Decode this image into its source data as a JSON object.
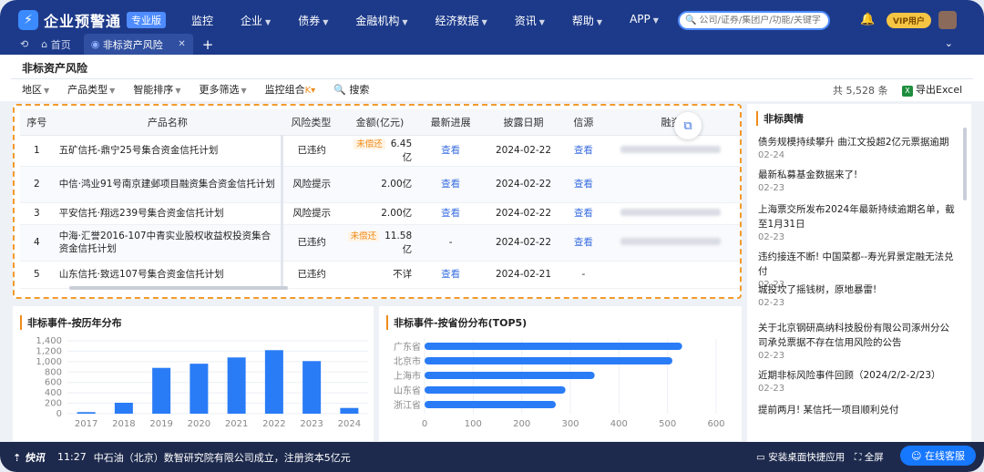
{
  "app": {
    "logo_glyph": "⚡",
    "name": "企业预警通",
    "badge": "专业版"
  },
  "nav": {
    "items": [
      {
        "label": "监控",
        "caret": false
      },
      {
        "label": "企业",
        "caret": true
      },
      {
        "label": "债券",
        "caret": true
      },
      {
        "label": "金融机构",
        "caret": true
      },
      {
        "label": "经济数据",
        "caret": true
      },
      {
        "label": "资讯",
        "caret": true
      },
      {
        "label": "帮助",
        "caret": true
      },
      {
        "label": "APP",
        "caret": true
      }
    ]
  },
  "search": {
    "placeholder": "公司/证券/集团户/功能/关键字"
  },
  "vip_label": "VIP用户",
  "tabs": {
    "home": "首页",
    "active": "非标资产风险"
  },
  "page": {
    "title": "非标资产风险"
  },
  "filters": {
    "region": "地区",
    "product_type": "产品类型",
    "smart_sort": "智能排序",
    "more_filters": "更多筛选",
    "monitor_group": "监控组合",
    "search": "搜索",
    "total": "共 5,528 条",
    "export": "导出Excel"
  },
  "table": {
    "headers": [
      "序号",
      "产品名称",
      "风险类型",
      "金额(亿元)",
      "最新进展",
      "披露日期",
      "信源",
      "融资"
    ],
    "rows": [
      {
        "no": "1",
        "name": "五矿信托-鼎宁25号集合资金信托计划",
        "risk": "已违约",
        "tag": "未偿还",
        "amount": "6.45亿",
        "progress": "查看",
        "date": "2024-02-22",
        "source": "查看"
      },
      {
        "no": "2",
        "name": "中信·鸿业91号南京建邺项目融资集合资金信托计划",
        "risk": "风险提示",
        "tag": "",
        "amount": "2.00亿",
        "progress": "查看",
        "date": "2024-02-22",
        "source": "查看"
      },
      {
        "no": "3",
        "name": "平安信托·翔远239号集合资金信托计划",
        "risk": "风险提示",
        "tag": "",
        "amount": "2.00亿",
        "progress": "查看",
        "date": "2024-02-22",
        "source": "查看"
      },
      {
        "no": "4",
        "name": "中海·汇誉2016-107中青实业股权收益权投资集合资金信托计划",
        "risk": "已违约",
        "tag": "未偿还",
        "amount": "11.58亿",
        "progress": "-",
        "date": "2024-02-22",
        "source": "查看"
      },
      {
        "no": "5",
        "name": "山东信托·致远107号集合资金信托计划",
        "risk": "已违约",
        "tag": "",
        "amount": "不详",
        "progress": "查看",
        "date": "2024-02-21",
        "source": "-"
      }
    ]
  },
  "chart_year": {
    "title": "非标事件-按历年分布",
    "chart_data": {
      "type": "bar",
      "categories": [
        "2017",
        "2018",
        "2019",
        "2020",
        "2021",
        "2022",
        "2023",
        "2024"
      ],
      "values": [
        30,
        210,
        880,
        960,
        1080,
        1220,
        1010,
        110
      ],
      "ylim": [
        0,
        1400
      ],
      "yticks": [
        "1,400",
        "1,200",
        "1,000",
        "800",
        "600",
        "400",
        "200",
        "0"
      ],
      "color": "#2a7cf6"
    }
  },
  "chart_province": {
    "title": "非标事件-按省份分布(TOP5)",
    "chart_data": {
      "type": "bar",
      "orientation": "horizontal",
      "categories": [
        "广东省",
        "北京市",
        "上海市",
        "山东省",
        "浙江省"
      ],
      "values": [
        530,
        510,
        350,
        290,
        270
      ],
      "xlim": [
        0,
        600
      ],
      "xticks": [
        "0",
        "100",
        "200",
        "300",
        "400",
        "500",
        "600"
      ],
      "color": "#2a7cf6"
    }
  },
  "news": {
    "title": "非标舆情",
    "items": [
      {
        "text": "债务规模持续攀升 曲江文投超2亿元票据逾期",
        "date": "02-24"
      },
      {
        "text": "最新私募基金数据来了!",
        "date": "02-23"
      },
      {
        "text": "上海票交所发布2024年最新持续逾期名单，截至1月31日",
        "date": "02-23"
      },
      {
        "text": "违约接连不断! 中国菜都--寿光昇景定融无法兑付",
        "date": "02-23"
      },
      {
        "text": "城投坎了摇钱树，原地暴雷!",
        "date": "02-23"
      },
      {
        "text": "关于北京钢研高纳科技股份有限公司涿州分公司承兑票据不存在信用风险的公告",
        "date": "02-23"
      },
      {
        "text": "近期非标风险事件回顾（2024/2/2-2/23）",
        "date": "02-23"
      },
      {
        "text": "提前两月! 某信托一项目顺利兑付",
        "date": ""
      }
    ]
  },
  "bottom": {
    "kuaixun": "快讯",
    "time": "11:27",
    "ticker": "中石油（北京）数智研究院有限公司成立，注册资本5亿元",
    "install": "安装桌面快捷应用",
    "fullscreen": "全屏",
    "service": "在线客服"
  }
}
